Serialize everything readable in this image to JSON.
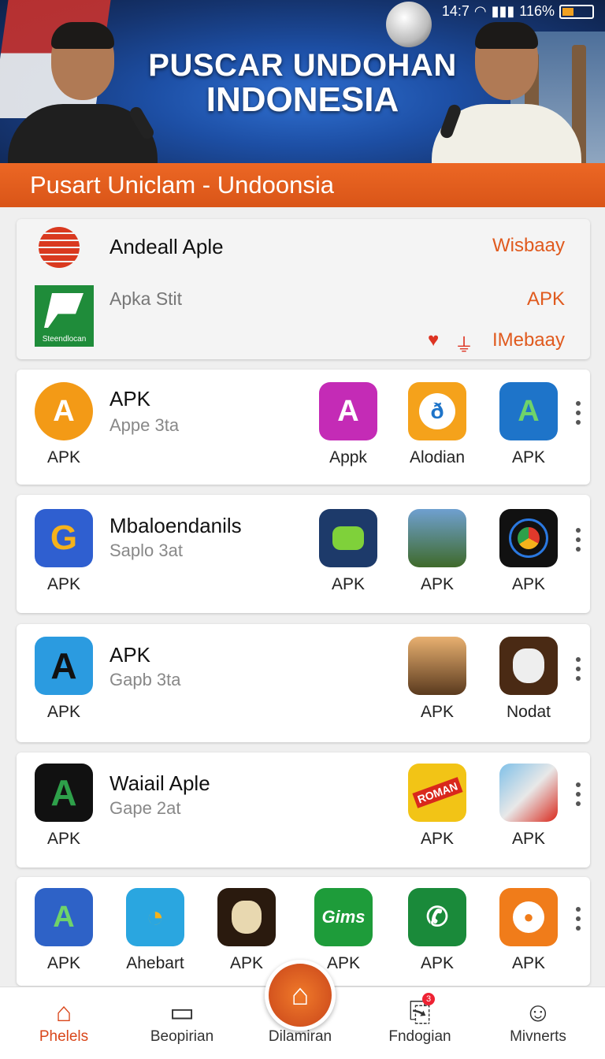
{
  "status_bar": {
    "time": "14:7",
    "battery": "116%"
  },
  "banner": {
    "title_line1": "PUSCAR UNDOHAN",
    "title_line2": "INDONESIA"
  },
  "section_header": "Pusart Uniclam - Undoonsia",
  "featured": {
    "title": "Andeall Aple",
    "subtitle": "Apka Stit",
    "green_icon_caption": "Steendlocan",
    "right_top": "Wisbaay",
    "right_mid": "APK",
    "right_bottom": "IMebaay"
  },
  "rows": [
    {
      "title": "APK",
      "subtitle": "Appe 3ta",
      "apps": [
        {
          "label": "APK",
          "icon": "orange-a-icon",
          "color": "#f39a16"
        },
        {
          "label": "Appk",
          "icon": "pink-a-icon",
          "color": "#c42bb6"
        },
        {
          "label": "Alodian",
          "icon": "chat-bubble-icon",
          "color": "#f5a21b"
        },
        {
          "label": "APK",
          "icon": "blue-a-icon",
          "color": "#1e74c9"
        }
      ]
    },
    {
      "title": "Mbaloendanils",
      "subtitle": "Saplo 3at",
      "apps": [
        {
          "label": "APK",
          "icon": "g-logo-icon",
          "color": "#2f5fd0"
        },
        {
          "label": "APK",
          "icon": "game-box-icon",
          "color": "#1d3a6a"
        },
        {
          "label": "APK",
          "icon": "soldiers-icon",
          "color": "#3f6a2a"
        },
        {
          "label": "APK",
          "icon": "chrome-icon",
          "color": "#111111"
        }
      ]
    },
    {
      "title": "APK",
      "subtitle": "Gapb 3ta",
      "apps": [
        {
          "label": "APK",
          "icon": "dark-a-icon",
          "color": "#2b9be0"
        },
        {
          "label": "APK",
          "icon": "wild-game-icon",
          "color": "#5a3a1e"
        },
        {
          "label": "Nodat",
          "icon": "goat-game-icon",
          "color": "#4a2a14"
        }
      ]
    },
    {
      "title": "Waiail Aple",
      "subtitle": "Gape 2at",
      "apps": [
        {
          "label": "APK",
          "icon": "black-a-icon",
          "color": "#111111"
        },
        {
          "label": "APK",
          "icon": "roman-game-icon",
          "color": "#f2c416"
        },
        {
          "label": "APK",
          "icon": "map-icon",
          "color": "#e8e8e8"
        }
      ]
    },
    {
      "apps": [
        {
          "label": "APK",
          "icon": "blue-a-icon",
          "color": "#2e62c7"
        },
        {
          "label": "Ahebart",
          "icon": "swirl-icon",
          "color": "#2aa6e0"
        },
        {
          "label": "APK",
          "icon": "goat-game-icon",
          "color": "#2a1a0e"
        },
        {
          "label": "APK",
          "icon": "gims-icon",
          "color": "#1e9c3a",
          "text": "Gims"
        },
        {
          "label": "APK",
          "icon": "whatsapp-icon",
          "color": "#1a8a3a"
        },
        {
          "label": "APK",
          "icon": "orange-chat-icon",
          "color": "#f07c1a"
        }
      ]
    }
  ],
  "nav": [
    {
      "label": "Phelels",
      "icon": "home-icon",
      "active": true
    },
    {
      "label": "Beopirian",
      "icon": "monitor-icon"
    },
    {
      "label": "Dilamiran",
      "icon": "center-fab-icon"
    },
    {
      "label": "Fndogian",
      "icon": "download-icon",
      "badge": "3"
    },
    {
      "label": "Mivnerts",
      "icon": "person-icon"
    }
  ],
  "colors": {
    "accent": "#e05a1e",
    "orange_bar": "#ec6724"
  }
}
